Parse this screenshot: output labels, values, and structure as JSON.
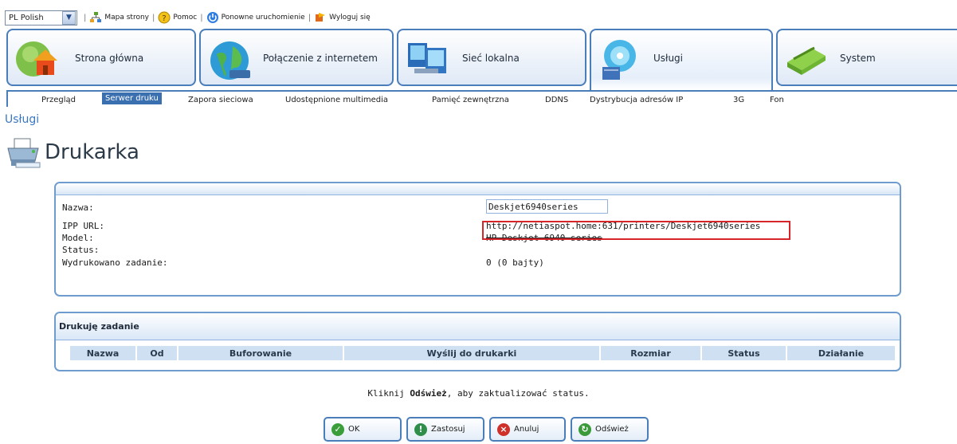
{
  "topbar": {
    "language_value": "PL Polish",
    "links": [
      {
        "label": "Mapa strony",
        "icon": "sitemap-icon"
      },
      {
        "label": "Pomoc",
        "icon": "help-icon"
      },
      {
        "label": "Ponowne uruchomienie",
        "icon": "restart-icon"
      },
      {
        "label": "Wyloguj się",
        "icon": "logout-icon"
      }
    ]
  },
  "nav": {
    "tiles": [
      {
        "label": "Strona główna",
        "icon": "house-icon"
      },
      {
        "label": "Połączenie z internetem",
        "icon": "globe-icon"
      },
      {
        "label": "Sieć lokalna",
        "icon": "network-computers-icon"
      },
      {
        "label": "Usługi",
        "icon": "services-disc-icon"
      },
      {
        "label": "System",
        "icon": "router-icon"
      }
    ],
    "active": "Usługi"
  },
  "subnav": {
    "items": [
      "Przegląd",
      "Serwer druku",
      "Zapora sieciowa",
      "Udostępnione multimedia",
      "Pamięć zewnętrzna",
      "DDNS",
      "Dystrybucja adresów IP",
      "3G",
      "Fon"
    ],
    "active": "Serwer druku"
  },
  "breadcrumb": "Usługi",
  "page_title": "Drukarka",
  "printer": {
    "name_label": "Nazwa:",
    "name_value": "Deskjet6940series",
    "ipp_label": "IPP URL:",
    "ipp_value": "http://netiaspot.home:631/printers/Deskjet6940series",
    "model_label": "Model:",
    "model_value": "HP Deskjet 6940 series",
    "status_label": "Status:",
    "printed_label": "Wydrukowano zadanie:",
    "printed_value": "0 (0 bajty)"
  },
  "jobs": {
    "title": "Drukuję zadanie",
    "columns": [
      "Nazwa",
      "Od",
      "Buforowanie",
      "Wyślij do drukarki",
      "Rozmiar",
      "Status",
      "Działanie"
    ]
  },
  "hint": {
    "prefix": "Kliknij ",
    "bold": "Odśwież",
    "suffix": ", aby zaktualizować status."
  },
  "buttons": {
    "ok": "OK",
    "apply": "Zastosuj",
    "cancel": "Anuluj",
    "refresh": "Odśwież"
  },
  "colors": {
    "accent": "#4a7ebb",
    "active_tab": "#3a6fb0",
    "highlight": "#d6262b"
  }
}
